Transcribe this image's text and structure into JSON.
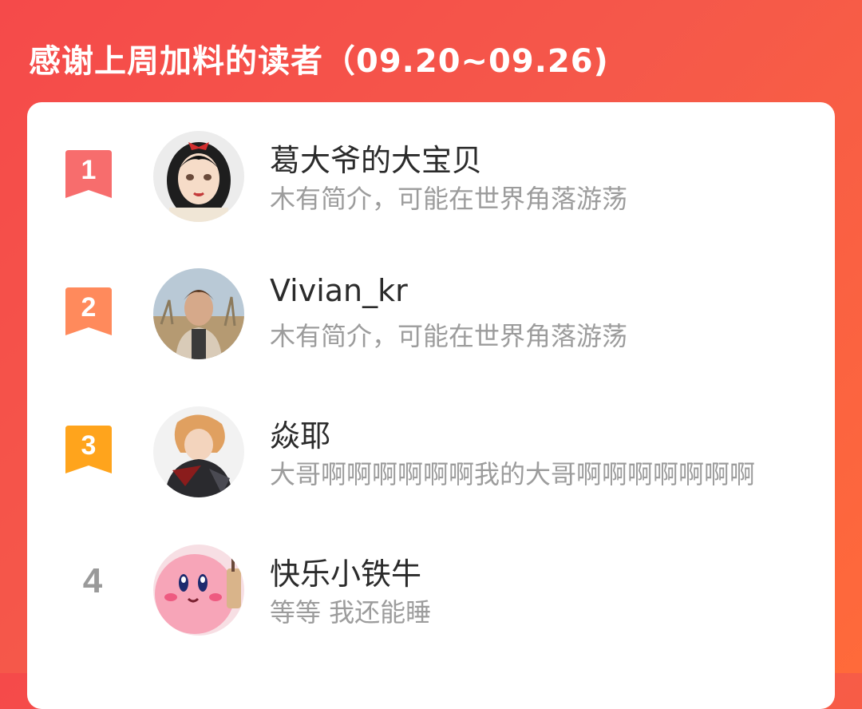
{
  "header": {
    "title": "感谢上周加料的读者（09.20~09.26)"
  },
  "colors": {
    "rank1": "#f76d6d",
    "rank2": "#ff8a5c",
    "rank3": "#ffa41c",
    "rank_plain": "#9a9a9a",
    "background": "#f54a4a"
  },
  "readers": [
    {
      "rank": "1",
      "name": "葛大爷的大宝贝",
      "bio": "木有简介，可能在世界角落游荡",
      "avatar_icon": "snow-white-avatar-icon"
    },
    {
      "rank": "2",
      "name": "Vivian_kr",
      "bio": "木有简介，可能在世界角落游荡",
      "avatar_icon": "man-portrait-avatar-icon"
    },
    {
      "rank": "3",
      "name": "焱耶",
      "bio": "大哥啊啊啊啊啊啊我的大哥啊啊啊啊啊啊啊",
      "avatar_icon": "anime-character-avatar-icon"
    },
    {
      "rank": "4",
      "name": "快乐小铁牛",
      "bio": "等等 我还能睡",
      "avatar_icon": "kirby-avatar-icon"
    }
  ]
}
